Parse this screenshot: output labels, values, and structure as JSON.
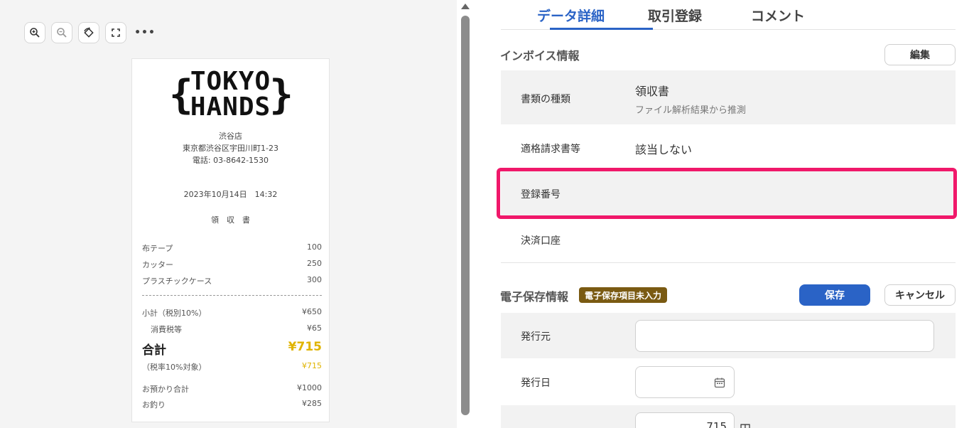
{
  "viewer": {
    "toolbar": {
      "zoom_in": "zoom-in-icon",
      "zoom_out": "zoom-out-icon",
      "rotate": "rotate-icon",
      "fullscreen": "fullscreen-icon",
      "more_label": "•••"
    },
    "receipt": {
      "logo_line1": "TOKYO",
      "logo_line2": "HANDS",
      "store": "渋谷店",
      "address": "東京都渋谷区宇田川町1-23",
      "phone": "電話: 03-8642-1530",
      "datetime": "2023年10月14日　14:32",
      "doc_title": "領　収　書",
      "items": [
        {
          "name": "布テープ",
          "price": "100"
        },
        {
          "name": "カッター",
          "price": "250"
        },
        {
          "name": "プラスチックケース",
          "price": "300"
        }
      ],
      "subtotal_label": "小計（税別10%）",
      "subtotal": "¥650",
      "tax_label": "消費税等",
      "tax": "¥65",
      "total_label": "合計",
      "total": "¥715",
      "taxable_label": "（税率10%対象）",
      "taxable": "¥715",
      "paid_label": "お預かり合計",
      "paid": "¥1000",
      "change_label": "お釣り",
      "change": "¥285"
    }
  },
  "tabs": [
    "データ詳細",
    "取引登録",
    "コメント"
  ],
  "invoice": {
    "title": "インボイス情報",
    "edit_label": "編集",
    "rows": [
      {
        "label": "書類の種類",
        "value": "領収書",
        "sub": "ファイル解析結果から推測"
      },
      {
        "label": "適格請求書等",
        "value": "該当しない"
      },
      {
        "label": "登録番号",
        "value": ""
      },
      {
        "label": "決済口座",
        "value": ""
      }
    ]
  },
  "estorage": {
    "title": "電子保存情報",
    "badge": "電子保存項目未入力",
    "save_label": "保存",
    "cancel_label": "キャンセル",
    "issuer_label": "発行元",
    "issuer_value": "",
    "date_label": "発行日",
    "date_value": "",
    "amount_value": "715",
    "amount_unit": "円"
  },
  "colors": {
    "accent": "#2a63c6",
    "highlight": "#f0186a",
    "badge": "#7a5a12",
    "receipt_total": "#e0b400"
  }
}
